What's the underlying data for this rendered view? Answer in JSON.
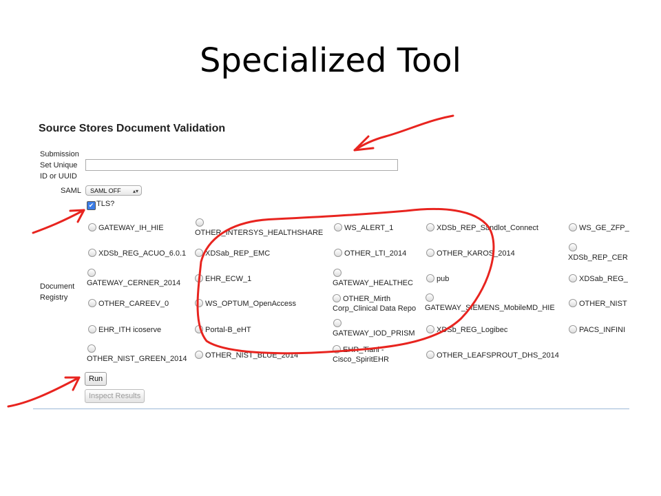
{
  "slide": {
    "title": "Specialized Tool"
  },
  "form": {
    "title": "Source Stores Document Validation",
    "submission_label_lines": [
      "Submission",
      "Set Unique",
      "ID or UUID"
    ],
    "submission_value": "",
    "saml_label": "SAML",
    "saml_selected": "SAML OFF",
    "tls_label": "TLS?",
    "tls_checked": true,
    "registry_label_lines": [
      "Document",
      "Registry"
    ],
    "options": [
      {
        "label": "GATEWAY_IH_HIE"
      },
      {
        "label": "OTHER_INTERSYS_HEALTHSHARE"
      },
      {
        "label": "WS_ALERT_1"
      },
      {
        "label": "XDSb_REP_Sandlot_Connect"
      },
      {
        "label": "WS_GE_ZFP_"
      },
      {
        "label": "XDSb_REG_ACUO_6.0.1"
      },
      {
        "label": "XDSab_REP_EMC"
      },
      {
        "label": "OTHER_LTI_2014"
      },
      {
        "label": "OTHER_KAROS_2014"
      },
      {
        "label": "XDSb_REP_CER"
      },
      {
        "label": "GATEWAY_CERNER_2014"
      },
      {
        "label": "EHR_ECW_1"
      },
      {
        "label": "GATEWAY_HEALTHEC"
      },
      {
        "label": "pub"
      },
      {
        "label": "XDSab_REG_"
      },
      {
        "label": "OTHER_CAREEV_0"
      },
      {
        "label": "WS_OPTUM_OpenAccess"
      },
      {
        "label": "OTHER_Mirth",
        "label2": "Corp_Clinical Data Repo"
      },
      {
        "label": "GATEWAY_SIEMENS_MobileMD_HIE"
      },
      {
        "label": "OTHER_NIST"
      },
      {
        "label": "EHR_ITH icoserve"
      },
      {
        "label": "Portal-B_eHT"
      },
      {
        "label": "GATEWAY_IOD_PRISM"
      },
      {
        "label": "XDSb_REG_Logibec"
      },
      {
        "label": "PACS_INFINI"
      },
      {
        "label": "OTHER_NIST_GREEN_2014"
      },
      {
        "label": "OTHER_NIST_BLUE_2014"
      },
      {
        "label": "EHR_Tiani -",
        "label2": "Cisco_SpiritEHR"
      },
      {
        "label": "OTHER_LEAFSPROUT_DHS_2014"
      }
    ],
    "run_label": "Run",
    "inspect_label": "Inspect Results"
  },
  "colors": {
    "annotation": "#e8241f",
    "rule": "#9cb8d6",
    "check": "#3b7ce6"
  }
}
